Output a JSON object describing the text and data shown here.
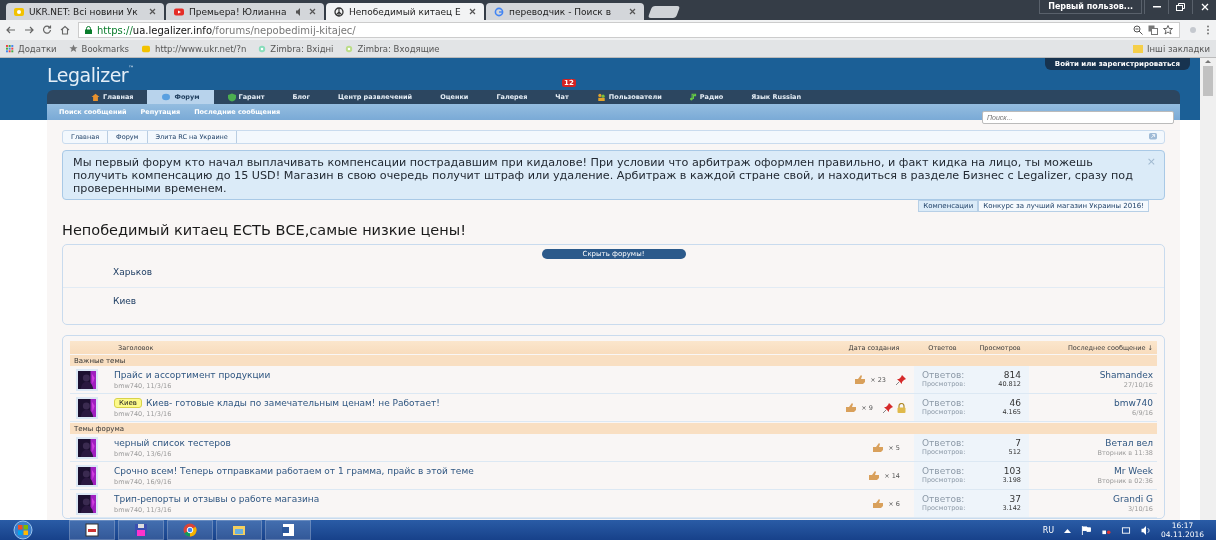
{
  "browser": {
    "tabs": [
      {
        "label": "UKR.NET: Всі новини Ук",
        "selected": false,
        "audio": false
      },
      {
        "label": "Премьера! Юлианна",
        "selected": false,
        "audio": true
      },
      {
        "label": "Непобедимый китаец Е",
        "selected": true,
        "audio": false
      },
      {
        "label": "переводчик - Поиск в",
        "selected": false,
        "audio": false
      }
    ],
    "user": "Первый пользов...",
    "url": {
      "scheme": "https://",
      "host": "ua.legalizer.info",
      "path": "/forums/nepobedimij-kitajec/"
    },
    "bookmarks": [
      "Додатки",
      "Bookmarks",
      "http://www.ukr.net/?n",
      "Zimbra: Вхідні",
      "Zimbra: Входящие"
    ],
    "other_bookmarks": "Інші закладки"
  },
  "site": {
    "logo": "Legalizer",
    "trademark": "™",
    "login": "Войти или зарегистрироваться",
    "nav": [
      {
        "label": "Главная",
        "selected": false
      },
      {
        "label": "Форум",
        "selected": true
      },
      {
        "label": "Гарант",
        "selected": false
      },
      {
        "label": "Блог",
        "selected": false
      },
      {
        "label": "Центр развлечений",
        "selected": false
      },
      {
        "label": "Оценки",
        "selected": false
      },
      {
        "label": "Галерея",
        "selected": false
      },
      {
        "label": "Чат",
        "selected": false,
        "badge": "12"
      },
      {
        "label": "Пользователи",
        "selected": false
      },
      {
        "label": "Радио",
        "selected": false
      },
      {
        "label": "Язык Russian",
        "selected": false
      }
    ],
    "subnav": [
      "Поиск сообщений",
      "Репутация",
      "Последние сообщения"
    ],
    "search": {
      "placeholder": "Поиск..."
    },
    "breadcrumbs": [
      "Главная",
      "Форум",
      "Элита RC на Украине"
    ],
    "notice": {
      "text": "Мы первый форум кто начал выплачивать компенсации пострадавшим при кидалове! При условии что арбитраж оформлен правильно, и факт кидка на лицо, ты можешь получить компенсацию до 15 USD! Магазин в свою очередь получит штраф или удаление. Арбитраж в каждой стране свой, и находиться в разделе Бизнес с Legalizer, сразу под проверенными временем.",
      "close": "×",
      "tabs": [
        {
          "label": "Компенсации",
          "selected": true
        },
        {
          "label": "Конкурс за лучший магазин Украины 2016!",
          "selected": false
        }
      ]
    },
    "title": "Непобедимый китаец ЕСТЬ ВСЕ,самые низкие цены!",
    "forums_toggle": "Скрыть форумы!",
    "subforums": [
      "Харьков",
      "Киев"
    ],
    "thread_list": {
      "columns": [
        "Заголовок",
        "Дата создания",
        "Ответов",
        "Просмотров",
        "Последнее сообщение ↓"
      ],
      "sections": [
        {
          "title": "Важные темы",
          "threads": [
            {
              "title": "Прайс и ассортимент продукции",
              "meta": "bmw740, 11/3/16",
              "likes": "× 23",
              "pinned": true,
              "locked": false,
              "replies_label": "Ответов:",
              "replies": "814",
              "views_label": "Просмотров:",
              "views": "40.812",
              "last_user": "Shamandex",
              "last_date": "27/10/16"
            },
            {
              "prefix": "Киев",
              "title": "Киев- готовые клады по замечательным ценам! не Работает!",
              "meta": "bmw740, 11/3/16",
              "likes": "× 9",
              "pinned": true,
              "locked": true,
              "replies_label": "Ответов:",
              "replies": "46",
              "views_label": "Просмотров:",
              "views": "4.165",
              "last_user": "bmw740",
              "last_date": "6/9/16"
            }
          ]
        },
        {
          "title": "Темы форума",
          "threads": [
            {
              "title": "черный список тестеров",
              "meta": "bmw740, 13/6/16",
              "likes": "× 5",
              "pinned": false,
              "locked": false,
              "replies_label": "Ответов:",
              "replies": "7",
              "views_label": "Просмотров:",
              "views": "512",
              "last_user": "Ветал вел",
              "last_date": "Вторник в 11:38"
            },
            {
              "title": "Срочно всем! Теперь отправками работаем от 1 грамма, прайс в этой теме",
              "meta": "bmw740, 16/9/16",
              "likes": "× 14",
              "pinned": false,
              "locked": false,
              "replies_label": "Ответов:",
              "replies": "103",
              "views_label": "Просмотров:",
              "views": "3.198",
              "last_user": "Mr Week",
              "last_date": "Вторник в 02:36"
            },
            {
              "title": "Трип-репорты и отзывы о работе магазина",
              "meta": "bmw740, 11/3/16",
              "likes": "× 6",
              "pinned": false,
              "locked": false,
              "replies_label": "Ответов:",
              "replies": "37",
              "views_label": "Просмотров:",
              "views": "3.142",
              "last_user": "Grandi G",
              "last_date": "3/10/16"
            }
          ]
        }
      ]
    }
  },
  "taskbar": {
    "language": "RU",
    "time": "16:17",
    "date": "04.11.2016"
  }
}
